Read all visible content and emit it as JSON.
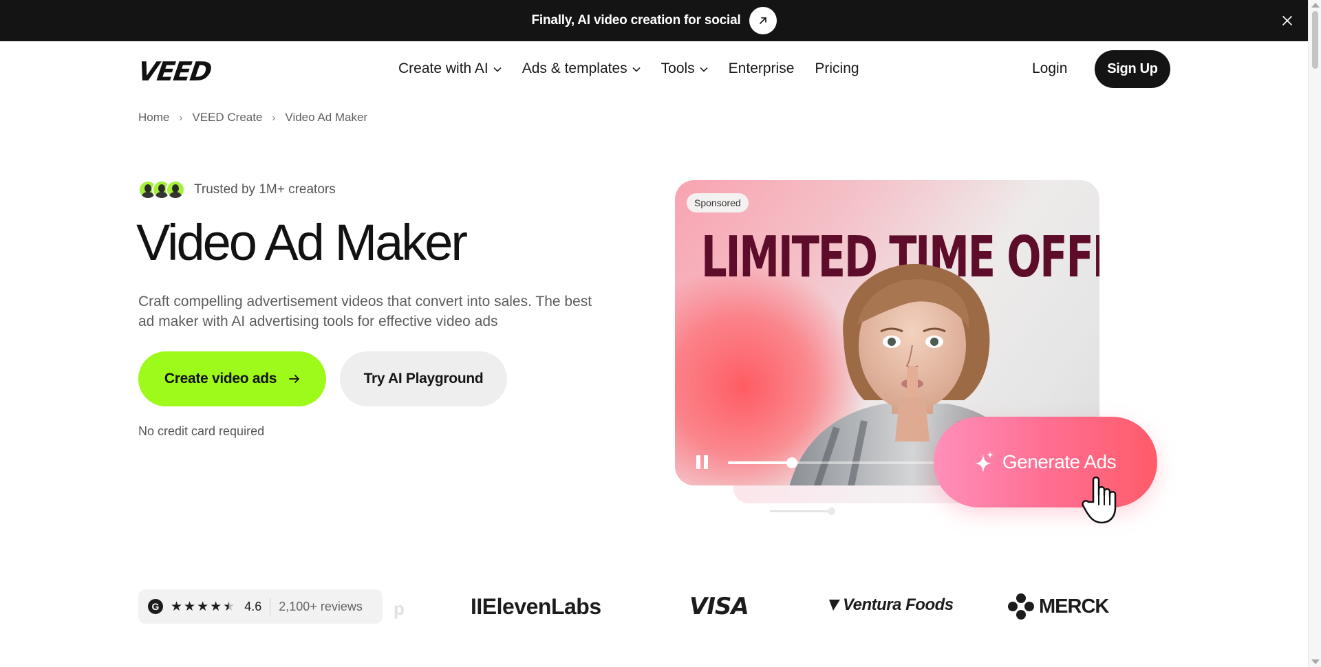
{
  "announcement": {
    "text": "Finally, AI video creation for social",
    "arrow_icon": "arrow-up-right-icon",
    "close_icon": "close-icon"
  },
  "nav": {
    "logo": "VEED",
    "items": [
      {
        "label": "Create with AI",
        "dropdown": true
      },
      {
        "label": "Ads & templates",
        "dropdown": true
      },
      {
        "label": "Tools",
        "dropdown": true
      },
      {
        "label": "Enterprise",
        "dropdown": false
      },
      {
        "label": "Pricing",
        "dropdown": false
      }
    ],
    "login": "Login",
    "signup": "Sign Up"
  },
  "breadcrumb": [
    "Home",
    "VEED Create",
    "Video Ad Maker"
  ],
  "hero": {
    "trusted": "Trusted by 1M+ creators",
    "title": "Video Ad Maker",
    "description": "Craft compelling advertisement videos that convert into sales. The best ad maker with AI advertising tools for effective video ads",
    "primary_cta": "Create video ads",
    "secondary_cta": "Try AI Playground",
    "note": "No credit card required"
  },
  "media": {
    "badge": "Sponsored",
    "headline": "LIMITED TIME OFFER",
    "generate_label": "Generate Ads",
    "progress": 0.31,
    "sparkle_icon": "sparkle-icon",
    "pause_icon": "pause-icon",
    "cursor_icon": "hand-cursor-icon"
  },
  "social_proof": {
    "rating_brand": "G",
    "rating": "4.6",
    "stars": 4.5,
    "reviews": "2,100+ reviews",
    "partial_logo": "p",
    "logos": [
      "IIElevenLabs",
      "VISA",
      "Ventura Foods",
      "MERCK"
    ]
  },
  "colors": {
    "accent_green": "#9efa1a",
    "dark": "#141414",
    "offer_text": "#5d0d2a",
    "generate_gradient_start": "#ff8fba",
    "generate_gradient_end": "#ff5b6a"
  }
}
